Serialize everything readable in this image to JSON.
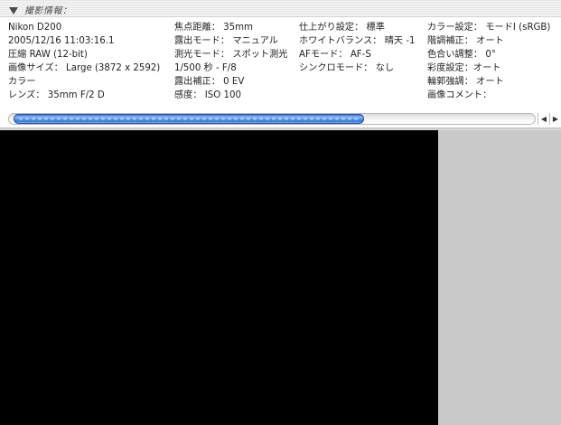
{
  "panel": {
    "title": "撮影情報："
  },
  "info": {
    "camera": [
      "Nikon D200",
      "2005/12/16 11:03:16.1",
      "圧縮 RAW (12-bit)",
      "画像サイズ： Large (3872 x 2592)",
      "カラー",
      "レンズ： 35mm F/2 D"
    ],
    "exposure": [
      "焦点距離： 35mm",
      "露出モード： マニュアル",
      "測光モード： スポット測光",
      "1/500 秒 - F/8",
      "露出補正： 0 EV",
      "感度： ISO 100"
    ],
    "settings": [
      "仕上がり設定： 標準",
      "ホワイトバランス： 晴天 -1",
      "AFモード： AF-S",
      "シンクロモード： なし"
    ],
    "color": [
      "カラー設定： モードI (sRGB)",
      "階調補正： オート",
      "色合い調整： 0°",
      "彩度設定：オート",
      "輪郭強調： オート",
      "画像コメント："
    ]
  },
  "scrollbar": {
    "left_arrow": "◀",
    "right_arrow": "▶",
    "position_fraction": 0.0,
    "visible_fraction": 0.66
  },
  "colors": {
    "thumb_blue": "#3a78d8",
    "image_background": "#000000",
    "side_background": "#c9c9c9"
  }
}
